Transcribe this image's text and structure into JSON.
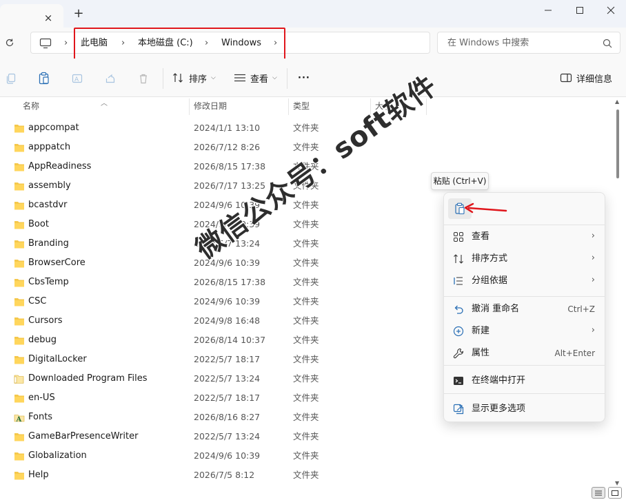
{
  "titlebar": {
    "new_tab": "+",
    "close_tab": "×"
  },
  "address": {
    "crumbs": [
      "此电脑",
      "本地磁盘 (C:)",
      "Windows"
    ],
    "search_placeholder": "在 Windows 中搜索"
  },
  "toolbar": {
    "sort_label": "排序",
    "view_label": "查看",
    "more_label": "···",
    "details_label": "详细信息"
  },
  "columns": {
    "name": "名称",
    "date": "修改日期",
    "type": "类型",
    "size": "大小"
  },
  "files": [
    {
      "name": "appcompat",
      "date": "2024/1/1 13:10",
      "type": "文件夹",
      "icon": "folder-icon"
    },
    {
      "name": "apppatch",
      "date": "2026/7/12 8:26",
      "type": "文件夹",
      "icon": "folder-icon"
    },
    {
      "name": "AppReadiness",
      "date": "2026/8/15 17:38",
      "type": "文件夹",
      "icon": "folder-icon"
    },
    {
      "name": "assembly",
      "date": "2026/7/17 13:25",
      "type": "文件夹",
      "icon": "folder-icon"
    },
    {
      "name": "bcastdvr",
      "date": "2024/9/6 10:39",
      "type": "文件夹",
      "icon": "folder-icon"
    },
    {
      "name": "Boot",
      "date": "2024/9/6 10:39",
      "type": "文件夹",
      "icon": "folder-icon"
    },
    {
      "name": "Branding",
      "date": "2022/5/7 13:24",
      "type": "文件夹",
      "icon": "folder-icon"
    },
    {
      "name": "BrowserCore",
      "date": "2024/9/6 10:39",
      "type": "文件夹",
      "icon": "folder-icon"
    },
    {
      "name": "CbsTemp",
      "date": "2026/8/15 17:38",
      "type": "文件夹",
      "icon": "folder-icon"
    },
    {
      "name": "CSC",
      "date": "2024/9/6 10:39",
      "type": "文件夹",
      "icon": "folder-icon"
    },
    {
      "name": "Cursors",
      "date": "2024/9/8 16:48",
      "type": "文件夹",
      "icon": "folder-icon"
    },
    {
      "name": "debug",
      "date": "2026/8/14 10:37",
      "type": "文件夹",
      "icon": "folder-icon"
    },
    {
      "name": "DigitalLocker",
      "date": "2022/5/7 18:17",
      "type": "文件夹",
      "icon": "folder-icon"
    },
    {
      "name": "Downloaded Program Files",
      "date": "2022/5/7 13:24",
      "type": "文件夹",
      "icon": "folder-shortcut-icon"
    },
    {
      "name": "en-US",
      "date": "2022/5/7 18:17",
      "type": "文件夹",
      "icon": "folder-icon"
    },
    {
      "name": "Fonts",
      "date": "2026/8/16 8:27",
      "type": "文件夹",
      "icon": "fonts-folder-icon"
    },
    {
      "name": "GameBarPresenceWriter",
      "date": "2022/5/7 13:24",
      "type": "文件夹",
      "icon": "folder-icon"
    },
    {
      "name": "Globalization",
      "date": "2024/9/6 10:39",
      "type": "文件夹",
      "icon": "folder-icon"
    },
    {
      "name": "Help",
      "date": "2026/7/5 8:12",
      "type": "文件夹",
      "icon": "folder-icon"
    }
  ],
  "watermark": "微信公众号：soft软件",
  "tooltip": "粘贴 (Ctrl+V)",
  "context_menu": {
    "items": [
      {
        "label": "查看",
        "shortcut": "",
        "submenu": true,
        "icon": "grid-icon"
      },
      {
        "label": "排序方式",
        "shortcut": "",
        "submenu": true,
        "icon": "sort-icon"
      },
      {
        "label": "分组依据",
        "shortcut": "",
        "submenu": true,
        "icon": "group-icon"
      },
      {
        "label": "撤消 重命名",
        "shortcut": "Ctrl+Z",
        "submenu": false,
        "icon": "undo-icon"
      },
      {
        "label": "新建",
        "shortcut": "",
        "submenu": true,
        "icon": "new-icon"
      },
      {
        "label": "属性",
        "shortcut": "Alt+Enter",
        "submenu": false,
        "icon": "wrench-icon"
      },
      {
        "label": "在终端中打开",
        "shortcut": "",
        "submenu": false,
        "icon": "terminal-icon"
      },
      {
        "label": "显示更多选项",
        "shortcut": "",
        "submenu": false,
        "icon": "more-options-icon"
      }
    ],
    "arrow": "›"
  },
  "colors": {
    "folder": "#f5c84c",
    "highlight_border": "#e0151b",
    "arrow": "#e0151b",
    "accent": "#0067c0"
  }
}
